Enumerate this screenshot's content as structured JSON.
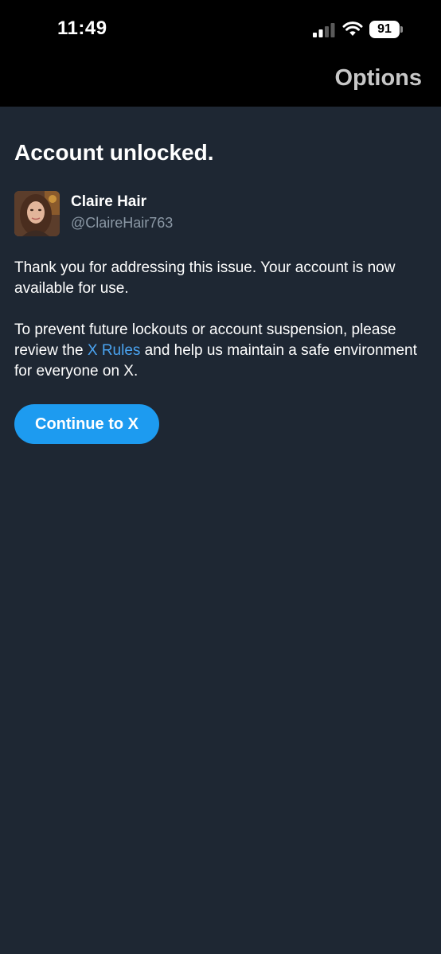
{
  "status_bar": {
    "time": "11:49",
    "battery": "91"
  },
  "nav": {
    "options_label": "Options"
  },
  "main": {
    "title": "Account unlocked.",
    "user": {
      "name": "Claire Hair",
      "handle": "@ClaireHair763"
    },
    "paragraph1": "Thank you for addressing this issue. Your account is now available for use.",
    "paragraph2_before": "To prevent future lockouts or account suspension, please review the ",
    "paragraph2_link": "X Rules",
    "paragraph2_after": " and help us maintain a safe environment for everyone on X.",
    "continue_label": "Continue to X"
  },
  "colors": {
    "background": "#1e2733",
    "top_bar": "#000000",
    "accent": "#1d9bf0",
    "link": "#4aa3f0",
    "secondary_text": "#8b98a5"
  },
  "icons": {
    "signal": "cellular-signal-icon",
    "wifi": "wifi-icon",
    "battery": "battery-icon"
  }
}
